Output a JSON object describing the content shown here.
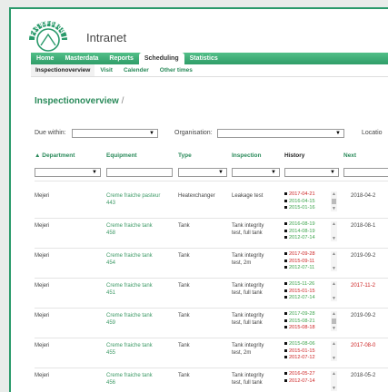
{
  "app": {
    "title": "Intranet",
    "logo_text": "FACTOFORCE"
  },
  "nav": {
    "items": [
      {
        "label": "Home",
        "active": false
      },
      {
        "label": "Masterdata",
        "active": false
      },
      {
        "label": "Reports",
        "active": false
      },
      {
        "label": "Scheduling",
        "active": true
      },
      {
        "label": "Statistics",
        "active": false
      }
    ]
  },
  "subnav": {
    "items": [
      {
        "label": "Inspectionoverview",
        "active": true
      },
      {
        "label": "Visit",
        "active": false
      },
      {
        "label": "Calender",
        "active": false
      },
      {
        "label": "Other times",
        "active": false
      }
    ]
  },
  "page": {
    "title": "Inspectionoverview",
    "title_suffix": "/"
  },
  "filters": {
    "due_within_label": "Due within:",
    "organisation_label": "Organisation:",
    "location_label": "Locatio"
  },
  "table": {
    "headers": {
      "department": "Department",
      "equipment": "Equipment",
      "type": "Type",
      "inspection": "Inspection",
      "history": "History",
      "next": "Next"
    },
    "sort_indicator": "▲",
    "rows": [
      {
        "department": "Mejeri",
        "equipment": "Creme fraiche pasteur",
        "equipment_no": "443",
        "type": "Heatexchanger",
        "inspection": "Leakage test",
        "inspection2": "",
        "history": [
          {
            "date": "2017-04-21",
            "color": "#cc2222"
          },
          {
            "date": "2016-04-15",
            "color": "#3aa34a"
          },
          {
            "date": "2015-01-16",
            "color": "#3aa34a"
          }
        ],
        "next": "2018-04-2",
        "next_color": "#444444"
      },
      {
        "department": "Mejeri",
        "equipment": "Creme fraiche tank",
        "equipment_no": "458",
        "type": "Tank",
        "inspection": "Tank integrity",
        "inspection2": "test, full tank",
        "history": [
          {
            "date": "2016-08-19",
            "color": "#3aa34a"
          },
          {
            "date": "2014-08-19",
            "color": "#3aa34a"
          },
          {
            "date": "2012-07-14",
            "color": "#3aa34a"
          }
        ],
        "next": "2018-08-1",
        "next_color": "#444444"
      },
      {
        "department": "Mejeri",
        "equipment": "Creme fraiche tank",
        "equipment_no": "454",
        "type": "Tank",
        "inspection": "Tank integrity",
        "inspection2": "test, 2m",
        "history": [
          {
            "date": "2017-09-28",
            "color": "#cc2222"
          },
          {
            "date": "2015-09-11",
            "color": "#cc2222"
          },
          {
            "date": "2012-07-11",
            "color": "#3aa34a"
          }
        ],
        "next": "2019-09-2",
        "next_color": "#444444"
      },
      {
        "department": "Mejeri",
        "equipment": "Creme fraiche tank",
        "equipment_no": "451",
        "type": "Tank",
        "inspection": "Tank integrity",
        "inspection2": "test, full tank",
        "history": [
          {
            "date": "2015-11-26",
            "color": "#3aa34a"
          },
          {
            "date": "2015-01-15",
            "color": "#cc2222"
          },
          {
            "date": "2012-07-14",
            "color": "#3aa34a"
          }
        ],
        "next": "2017-11-2",
        "next_color": "#cc2222"
      },
      {
        "department": "Mejeri",
        "equipment": "Creme fraiche tank",
        "equipment_no": "459",
        "type": "Tank",
        "inspection": "Tank integrity",
        "inspection2": "test, full tank",
        "history": [
          {
            "date": "2017-09-28",
            "color": "#3aa34a"
          },
          {
            "date": "2015-08-21",
            "color": "#3aa34a"
          },
          {
            "date": "2015-08-18",
            "color": "#cc2222"
          }
        ],
        "next": "2019-09-2",
        "next_color": "#444444"
      },
      {
        "department": "Mejeri",
        "equipment": "Creme fraiche tank",
        "equipment_no": "455",
        "type": "Tank",
        "inspection": "Tank integrity",
        "inspection2": "test, 2m",
        "history": [
          {
            "date": "2015-08-06",
            "color": "#3aa34a"
          },
          {
            "date": "2015-01-15",
            "color": "#cc2222"
          },
          {
            "date": "2012-07-12",
            "color": "#cc2222"
          }
        ],
        "next": "2017-08-0",
        "next_color": "#cc2222"
      },
      {
        "department": "Mejeri",
        "equipment": "Creme fraiche tank",
        "equipment_no": "456",
        "type": "Tank",
        "inspection": "Tank integrity",
        "inspection2": "test, full tank",
        "history": [
          {
            "date": "2016-05-27",
            "color": "#cc2222"
          },
          {
            "date": "2012-07-14",
            "color": "#cc2222"
          }
        ],
        "next": "2018-05-2",
        "next_color": "#444444"
      }
    ]
  },
  "colors": {
    "brand_green": "#2a8a5a",
    "nav_green": "#3fae78",
    "overdue_red": "#cc2222",
    "ok_green": "#3aa34a"
  }
}
